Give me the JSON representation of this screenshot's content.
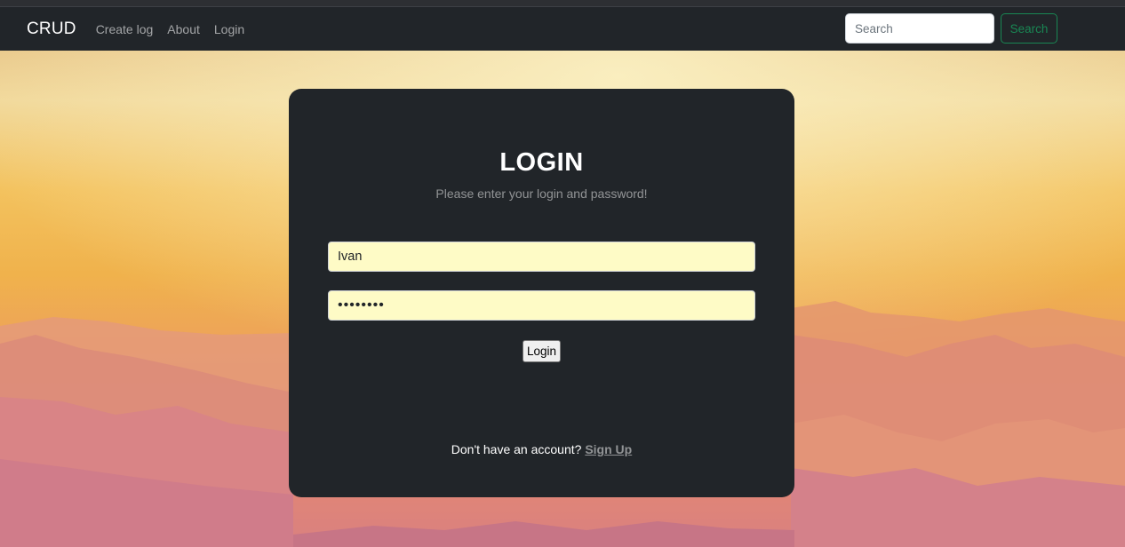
{
  "navbar": {
    "brand": "CRUD",
    "links": [
      {
        "label": "Create log"
      },
      {
        "label": "About"
      },
      {
        "label": "Login"
      }
    ],
    "search": {
      "placeholder": "Search",
      "button_label": "Search"
    }
  },
  "login_card": {
    "title": "LOGIN",
    "subtitle": "Please enter your login and password!",
    "username_value": "Ivan",
    "password_value": "password",
    "submit_label": "Login",
    "signup_prompt": "Don't have an account?",
    "signup_link": "Sign Up"
  },
  "colors": {
    "navbar_bg": "#212529",
    "card_bg": "#212529",
    "search_button_accent": "#198754",
    "autofill_bg": "#fefbc6"
  }
}
